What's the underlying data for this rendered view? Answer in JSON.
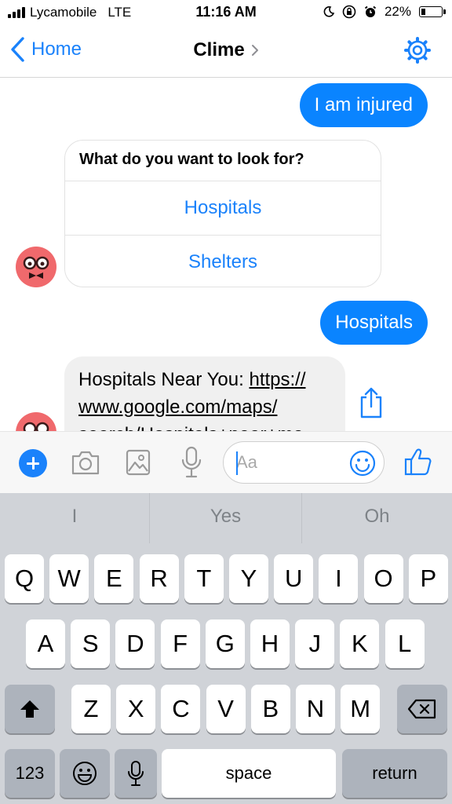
{
  "status_bar": {
    "carrier": "Lycamobile",
    "network": "LTE",
    "time": "11:16 AM",
    "battery_percent": "22%",
    "battery_level": 0.22
  },
  "nav": {
    "back_label": "Home",
    "title": "Clime",
    "accent_color": "#1a82fb"
  },
  "chat": {
    "messages": [
      {
        "from": "user",
        "text": "I am injured"
      },
      {
        "from": "bot",
        "card": {
          "question": "What do you want to look for?",
          "options": [
            "Hospitals",
            "Shelters"
          ]
        }
      },
      {
        "from": "user",
        "text": "Hospitals"
      },
      {
        "from": "bot",
        "prefix": "Hospitals Near You: ",
        "link": "https://www.google.com/maps/search/Hospitals+near+me",
        "link_lines": [
          "https://",
          "www.google.com/maps/",
          "search/Hospitals+near+me"
        ]
      }
    ],
    "bubble_color": "#0a84ff"
  },
  "composer": {
    "placeholder": "Aa",
    "icons": [
      "plus-icon",
      "camera-icon",
      "image-icon",
      "microphone-icon",
      "emoji-icon",
      "thumbs-up-icon"
    ]
  },
  "keyboard": {
    "suggestions": [
      "I",
      "Yes",
      "Oh"
    ],
    "rows": [
      [
        "Q",
        "W",
        "E",
        "R",
        "T",
        "Y",
        "U",
        "I",
        "O",
        "P"
      ],
      [
        "A",
        "S",
        "D",
        "F",
        "G",
        "H",
        "J",
        "K",
        "L"
      ],
      [
        "Z",
        "X",
        "C",
        "V",
        "B",
        "N",
        "M"
      ]
    ],
    "numbers_label": "123",
    "space_label": "space",
    "return_label": "return"
  }
}
